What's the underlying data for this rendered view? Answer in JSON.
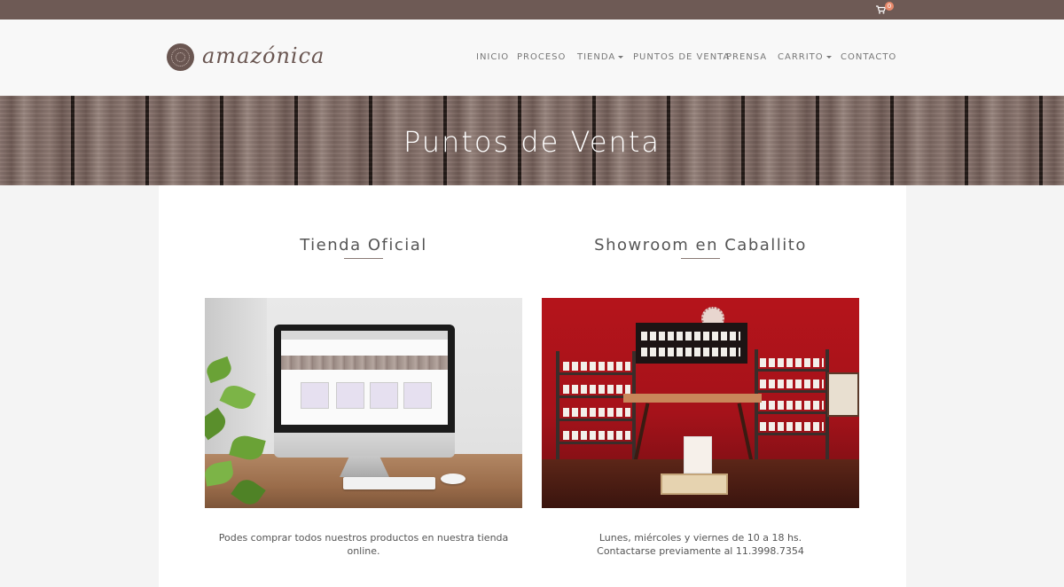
{
  "topbar": {
    "cart_icon": "shopping-cart-icon",
    "cart_count": "0"
  },
  "header": {
    "logo_text": "amazónica",
    "nav": [
      {
        "label": "INICIO",
        "dropdown": false
      },
      {
        "label": "PROCESO",
        "dropdown": false
      },
      {
        "label": "TIENDA",
        "dropdown": true
      },
      {
        "label": "PUNTOS DE VENTA",
        "dropdown": false
      },
      {
        "label": "PRENSA",
        "dropdown": false
      },
      {
        "label": "CARRITO",
        "dropdown": true
      },
      {
        "label": "CONTACTO",
        "dropdown": false
      }
    ]
  },
  "hero": {
    "title": "Puntos de Venta"
  },
  "columns": [
    {
      "title": "Tienda Oficial",
      "caption_lines": [
        "Podes comprar todos nuestros productos en nuestra tienda online."
      ]
    },
    {
      "title": "Showroom en Caballito",
      "caption_lines": [
        "Lunes, miércoles y viernes de 10 a 18 hs.",
        "Contactarse previamente al 11.3998.7354"
      ]
    }
  ],
  "colors": {
    "topbar": "#6e5a55",
    "brand": "#6a5651",
    "cart_badge": "#e8896b"
  }
}
